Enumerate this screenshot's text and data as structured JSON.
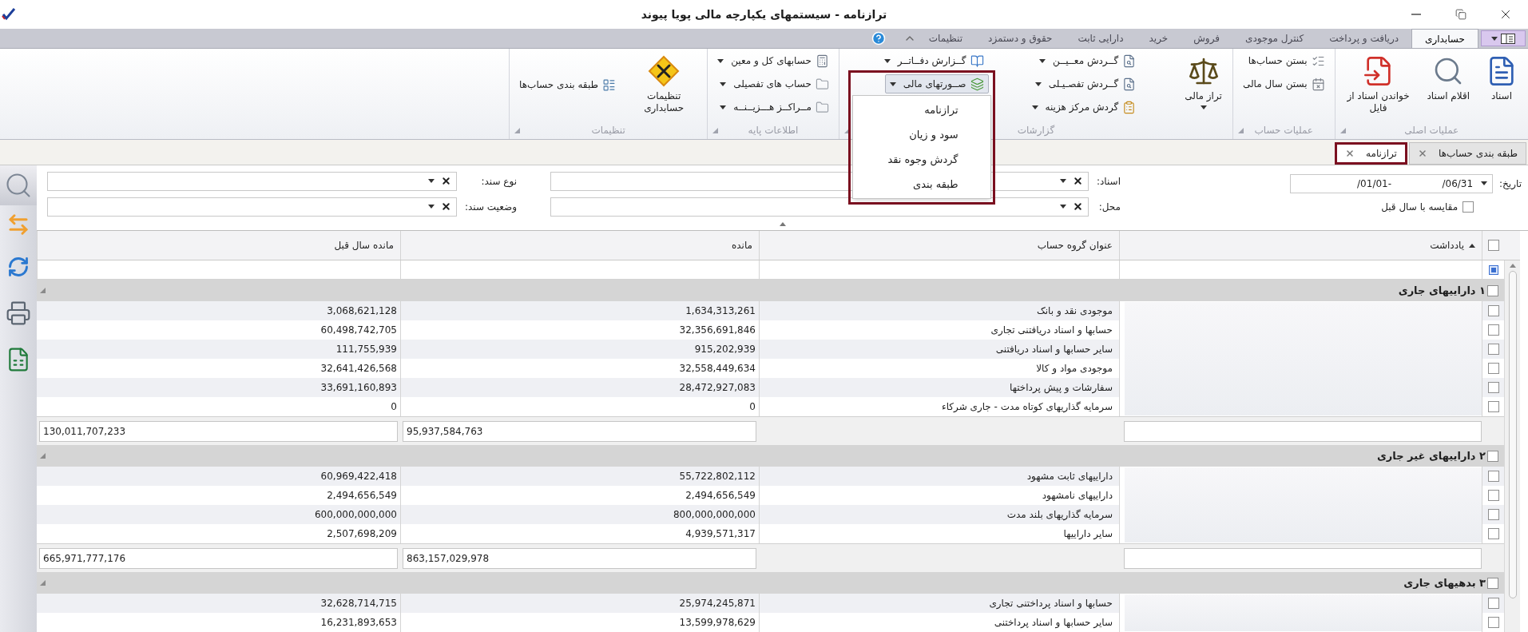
{
  "window": {
    "title": "ترازنامه - سیستمهای یکپارچه مالی پویا پیوند"
  },
  "ribbon_tabs": [
    {
      "label": "حسابداری",
      "selected": true
    },
    {
      "label": "دریافت و پرداخت",
      "selected": false
    },
    {
      "label": "کنترل موجودی",
      "selected": false
    },
    {
      "label": "فروش",
      "selected": false
    },
    {
      "label": "خرید",
      "selected": false
    },
    {
      "label": "دارایی ثابت",
      "selected": false
    },
    {
      "label": "حقوق و دستمزد",
      "selected": false
    },
    {
      "label": "تنظیمات",
      "selected": false
    }
  ],
  "ribbon_groups": [
    {
      "label": "عملیات اصلی",
      "items": [
        {
          "kind": "large",
          "label": "اسناد",
          "dropdown": false,
          "pressed": false
        },
        {
          "kind": "large",
          "label": "اقلام اسناد",
          "dropdown": false,
          "pressed": false
        },
        {
          "kind": "large",
          "label": "خواندن اسناد از فایل",
          "dropdown": false,
          "pressed": false
        }
      ]
    },
    {
      "label": "عملیات حساب",
      "items": [
        {
          "kind": "small",
          "label": "بستن حساب‌ها",
          "dropdown": false,
          "pressed": false
        },
        {
          "kind": "small",
          "label": "بستن سال مالی",
          "dropdown": false,
          "pressed": false
        }
      ]
    },
    {
      "label": "گزارشات",
      "items": [
        {
          "kind": "large",
          "label": "تراز مالی",
          "dropdown": true,
          "pressed": false
        },
        {
          "kind": "small",
          "label": "گــردش معــیــن",
          "dropdown": true,
          "pressed": false
        },
        {
          "kind": "small",
          "label": "گــردش تفصـیـلی",
          "dropdown": true,
          "pressed": false
        },
        {
          "kind": "small",
          "label": "گردش مرکز هزینه",
          "dropdown": true,
          "pressed": false
        },
        {
          "kind": "small",
          "label": "گــزارش دفــاتــر",
          "dropdown": true,
          "pressed": false
        },
        {
          "kind": "small",
          "label": "صــورتهای مالی",
          "dropdown": true,
          "pressed": true,
          "menu": {
            "highlighted": true,
            "items": [
              "ترازنامه",
              "سود و زیان",
              "گردش وجوه نقد",
              "طبقه بندی"
            ]
          }
        }
      ]
    },
    {
      "label": "اطلاعات پایه",
      "items": [
        {
          "kind": "small",
          "label": "حسابهای کل و معین",
          "dropdown": true,
          "pressed": false
        },
        {
          "kind": "small",
          "label": "حساب های تفصیلی",
          "dropdown": true,
          "pressed": false
        },
        {
          "kind": "small",
          "label": "مــراکــز هـــزیــنــه",
          "dropdown": true,
          "pressed": false
        }
      ]
    },
    {
      "label": "تنظیمات",
      "items": [
        {
          "kind": "large",
          "label": "تنظیمات حسابداری",
          "dropdown": false,
          "pressed": false
        },
        {
          "kind": "small",
          "label": "طبقه بندی حساب‌ها",
          "dropdown": false,
          "pressed": false
        }
      ]
    }
  ],
  "document_tabs": [
    {
      "label": "طبقه بندی حساب‌ها",
      "selected": false,
      "highlighted": false
    },
    {
      "label": "ترازنامه",
      "selected": true,
      "highlighted": true
    }
  ],
  "filters": {
    "date": {
      "label": "تاریخ:",
      "values": [
        "/06/31",
        "/01/01-"
      ]
    },
    "compare": {
      "label": "مقایسه با سال قبل",
      "checked": false
    },
    "documents": {
      "label": "اسناد:"
    },
    "location": {
      "label": "محل:"
    },
    "document_type": {
      "label": "نوع سند:"
    },
    "document_status": {
      "label": "وضعیت سند:"
    }
  },
  "table": {
    "header_checked": false,
    "columns": [
      "یادداشت",
      "عنوان گروه حساب",
      "مانده",
      "مانده سال قبل"
    ],
    "groups": [
      {
        "title": "۱ داراییهای جاری",
        "checked": false,
        "rows": [
          {
            "title": "موجودی نقد و بانک",
            "balance": "1,634,313,261",
            "previous": "3,068,621,128",
            "checked": false
          },
          {
            "title": "حسابها و اسناد دریافتنی تجاری",
            "balance": "32,356,691,846",
            "previous": "60,498,742,705",
            "checked": false
          },
          {
            "title": "سایر حسابها و اسناد دریافتنی",
            "balance": "915,202,939",
            "previous": "111,755,939",
            "checked": false
          },
          {
            "title": "موجودی مواد و کالا",
            "balance": "32,558,449,634",
            "previous": "32,641,426,568",
            "checked": false
          },
          {
            "title": "سفارشات و پیش پرداختها",
            "balance": "28,472,927,083",
            "previous": "33,691,160,893",
            "checked": false
          },
          {
            "title": "سرمایه گذاریهای کوتاه مدت - جاری شرکاء",
            "balance": "0",
            "previous": "0",
            "checked": false
          }
        ],
        "total": {
          "balance": "95,937,584,763",
          "previous": "130,011,707,233"
        }
      },
      {
        "title": "۲ داراییهای غیر جاری",
        "checked": false,
        "rows": [
          {
            "title": "داراییهای ثابت مشهود",
            "balance": "55,722,802,112",
            "previous": "60,969,422,418",
            "checked": false
          },
          {
            "title": "داراییهای نامشهود",
            "balance": "2,494,656,549",
            "previous": "2,494,656,549",
            "checked": false
          },
          {
            "title": "سرمایه گذاریهای بلند مدت",
            "balance": "800,000,000,000",
            "previous": "600,000,000,000",
            "checked": false
          },
          {
            "title": "سایر داراییها",
            "balance": "4,939,571,317",
            "previous": "2,507,698,209",
            "checked": false
          }
        ],
        "total": {
          "balance": "863,157,029,978",
          "previous": "665,971,777,176"
        }
      },
      {
        "title": "۳ بدهیهای جاری",
        "checked": false,
        "rows": [
          {
            "title": "حسابها و اسناد پرداختنی تجاری",
            "balance": "25,974,245,871",
            "previous": "32,628,714,715",
            "checked": false
          },
          {
            "title": "سایر حسابها و اسناد پرداختنی",
            "balance": "13,599,978,629",
            "previous": "16,231,893,653",
            "checked": false
          }
        ]
      }
    ]
  }
}
